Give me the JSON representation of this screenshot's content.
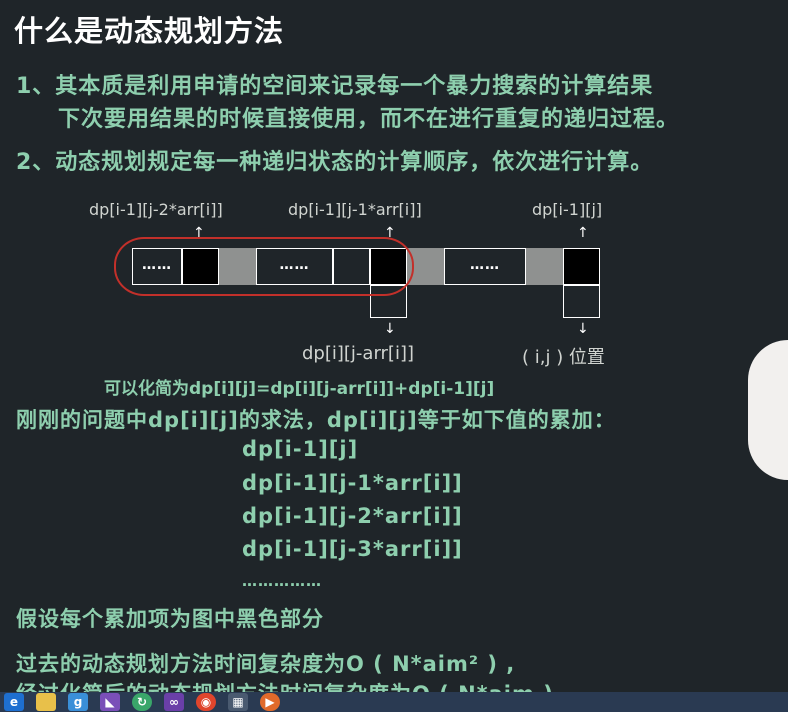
{
  "title": "什么是动态规划方法",
  "points": [
    "1、其本质是利用申请的空间来记录每一个暴力搜索的计算结果",
    "下次要用结果的时候直接使用，而不在进行重复的递归过程。",
    "2、动态规划规定每一种递归状态的计算顺序，依次进行计算。"
  ],
  "diagram": {
    "top_labels": [
      "dp[i-1][j-2*arr[i]]",
      "dp[i-1][j-1*arr[i]]",
      "dp[i-1][j]"
    ],
    "bottom_labels": [
      "dp[i][j-arr[i]]",
      "( i,j ) 位置"
    ],
    "dots": "……",
    "simplify": "可以化简为dp[i][j]=dp[i][j-arr[i]]+dp[i-1][j]"
  },
  "question": "刚刚的问题中dp[i][j]的求法，dp[i][j]等于如下值的累加：",
  "dp_terms": [
    "dp[i-1][j]",
    "dp[i-1][j-1*arr[i]]",
    "dp[i-1][j-2*arr[i]]",
    "dp[i-1][j-3*arr[i]]",
    "……………"
  ],
  "assume": "假设每个累加项为图中黑色部分",
  "complexity_old": "过去的动态规划方法时间复杂度为O ( N*aim² ) ,",
  "complexity_new": "经过化简后的动态规划方法时间复杂度为O ( N*aim )",
  "taskbar_icons": [
    "ie-icon",
    "folder-icon",
    "app-icon",
    "visual-studio-icon",
    "refresh-icon",
    "visual-studio-icon",
    "chrome-icon",
    "media-icon",
    "media-player-icon"
  ]
}
